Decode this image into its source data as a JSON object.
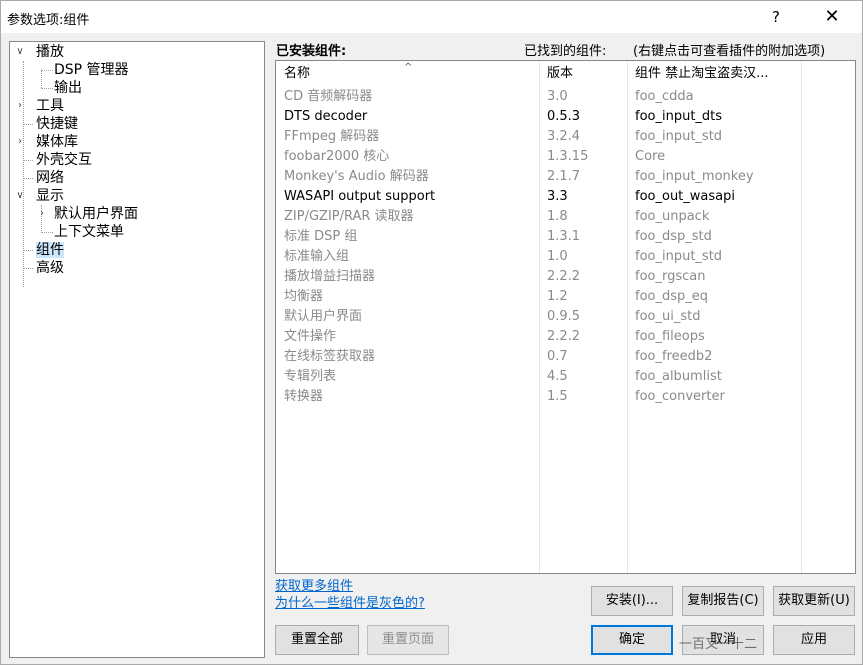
{
  "window": {
    "title": "参数选项:组件",
    "help_symbol": "?",
    "close_symbol": "✕"
  },
  "tree": {
    "items": [
      {
        "label": "播放",
        "expanded": true
      },
      {
        "label": "DSP 管理器"
      },
      {
        "label": "输出"
      },
      {
        "label": "工具",
        "expanded": false
      },
      {
        "label": "快捷键"
      },
      {
        "label": "媒体库",
        "expanded": false
      },
      {
        "label": "外壳交互"
      },
      {
        "label": "网络"
      },
      {
        "label": "显示",
        "expanded": true
      },
      {
        "label": "默认用户界面",
        "expanded": false
      },
      {
        "label": "上下文菜单"
      },
      {
        "label": "组件",
        "selected": true
      },
      {
        "label": "高级"
      }
    ]
  },
  "panel": {
    "installed_label": "已安装组件:",
    "found_label": "已找到的组件:",
    "found_hint": "(右键点击可查看插件的附加选项)"
  },
  "list": {
    "columns": [
      "名称",
      "版本",
      "组件 禁止淘宝盗卖汉..."
    ],
    "sort_arrow": "^",
    "rows": [
      {
        "name": "CD 音频解码器",
        "version": "3.0",
        "module": "foo_cdda",
        "style": "gray"
      },
      {
        "name": "DTS decoder",
        "version": "0.5.3",
        "module": "foo_input_dts",
        "style": "dark"
      },
      {
        "name": "FFmpeg 解码器",
        "version": "3.2.4",
        "module": "foo_input_std",
        "style": "gray"
      },
      {
        "name": "foobar2000 核心",
        "version": "1.3.15",
        "module": "Core",
        "style": "gray"
      },
      {
        "name": "Monkey's Audio 解码器",
        "version": "2.1.7",
        "module": "foo_input_monkey",
        "style": "gray"
      },
      {
        "name": "WASAPI output support",
        "version": "3.3",
        "module": "foo_out_wasapi",
        "style": "dark"
      },
      {
        "name": "ZIP/GZIP/RAR 读取器",
        "version": "1.8",
        "module": "foo_unpack",
        "style": "gray"
      },
      {
        "name": "标准 DSP 组",
        "version": "1.3.1",
        "module": "foo_dsp_std",
        "style": "gray"
      },
      {
        "name": "标准输入组",
        "version": "1.0",
        "module": "foo_input_std",
        "style": "gray"
      },
      {
        "name": "播放增益扫描器",
        "version": "2.2.2",
        "module": "foo_rgscan",
        "style": "gray"
      },
      {
        "name": "均衡器",
        "version": "1.2",
        "module": "foo_dsp_eq",
        "style": "gray"
      },
      {
        "name": "默认用户界面",
        "version": "0.9.5",
        "module": "foo_ui_std",
        "style": "gray"
      },
      {
        "name": "文件操作",
        "version": "2.2.2",
        "module": "foo_fileops",
        "style": "gray"
      },
      {
        "name": "在线标签获取器",
        "version": "0.7",
        "module": "foo_freedb2",
        "style": "gray"
      },
      {
        "name": "专辑列表",
        "version": "4.5",
        "module": "foo_albumlist",
        "style": "gray"
      },
      {
        "name": "转换器",
        "version": "1.5",
        "module": "foo_converter",
        "style": "gray"
      }
    ]
  },
  "links": {
    "more_components": "获取更多组件",
    "why_gray": "为什么一些组件是灰色的?"
  },
  "buttons": {
    "install": "安装(I)...",
    "copy_report": "复制报告(C)",
    "get_updates": "获取更新(U)",
    "reset_all": "重置全部",
    "reset_page": "重置页面",
    "ok": "确定",
    "cancel": "取消",
    "apply": "应用"
  },
  "watermark": "一百又一十二"
}
